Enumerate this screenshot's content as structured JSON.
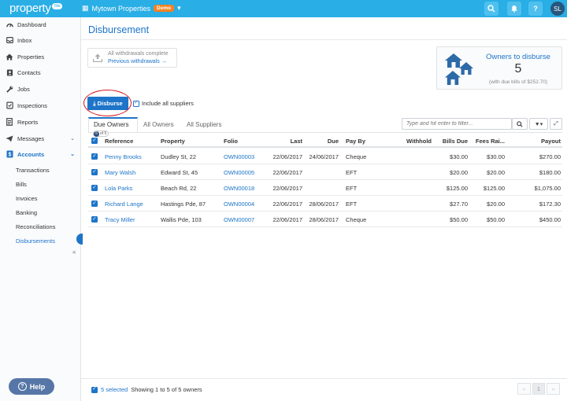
{
  "app": {
    "logo_text": "property",
    "logo_badge": "me"
  },
  "header": {
    "property_name": "Mytown Properties",
    "env_badge": "Demo",
    "avatar_initials": "SL"
  },
  "colors": {
    "brand_bar": "#29aee6",
    "accent": "#1d74c8",
    "demo_badge": "#f58220",
    "highlight_circle": "#d5141a"
  },
  "sidebar": {
    "items": [
      {
        "label": "Dashboard",
        "icon": "dashboard-icon"
      },
      {
        "label": "Inbox",
        "icon": "inbox-icon"
      },
      {
        "label": "Properties",
        "icon": "home-icon"
      },
      {
        "label": "Contacts",
        "icon": "contact-card-icon"
      },
      {
        "label": "Jobs",
        "icon": "wrench-icon"
      },
      {
        "label": "Inspections",
        "icon": "checklist-icon"
      },
      {
        "label": "Reports",
        "icon": "report-icon"
      },
      {
        "label": "Messages",
        "icon": "paper-plane-icon"
      },
      {
        "label": "Accounts",
        "icon": "dollar-book-icon"
      }
    ],
    "account_sub": [
      "Transactions",
      "Bills",
      "Invoices",
      "Banking",
      "Reconciliations",
      "Disbursements"
    ],
    "help_label": "Help"
  },
  "page": {
    "title": "Disbursement"
  },
  "withdrawals": {
    "status": "All withdrawals complete",
    "link": "Previous withdrawals →"
  },
  "summary": {
    "label": "Owners to disburse",
    "count": "5",
    "note": "(with due bills of $252.70)"
  },
  "actions": {
    "disburse_label": "Disburse",
    "include_label": "Include all suppliers"
  },
  "tabs": [
    "Due Owners",
    "All Owners",
    "All Suppliers"
  ],
  "selection_pill": {
    "count": "5",
    "of": "of 5"
  },
  "filter": {
    "placeholder": "Type and hit enter to filter..."
  },
  "table": {
    "headers": [
      "Reference",
      "Property",
      "Folio",
      "Last",
      "Due",
      "Pay By",
      "Withhold",
      "Bills Due",
      "Fees Rai...",
      "Payout"
    ],
    "rows": [
      {
        "reference": "Penny Brooks",
        "property": "Dudley St, 22",
        "folio": "OWN00003",
        "last": "22/06/2017",
        "due": "24/06/2017",
        "pay_by": "Cheque",
        "withhold": "",
        "bills_due": "$30.00",
        "fees": "$30.00",
        "payout": "$270.00"
      },
      {
        "reference": "Mary Walsh",
        "property": "Edward St, 45",
        "folio": "OWN00005",
        "last": "22/06/2017",
        "due": "",
        "pay_by": "EFT",
        "withhold": "",
        "bills_due": "$20.00",
        "fees": "$20.00",
        "payout": "$180.00"
      },
      {
        "reference": "Lola Parks",
        "property": "Beach Rd, 22",
        "folio": "OWN00018",
        "last": "22/06/2017",
        "due": "",
        "pay_by": "EFT",
        "withhold": "",
        "bills_due": "$125.00",
        "fees": "$125.00",
        "payout": "$1,075.00"
      },
      {
        "reference": "Richard Lange",
        "property": "Hastings Pde, 87",
        "folio": "OWN00004",
        "last": "22/06/2017",
        "due": "28/06/2017",
        "pay_by": "EFT",
        "withhold": "",
        "bills_due": "$27.70",
        "fees": "$20.00",
        "payout": "$172.30"
      },
      {
        "reference": "Tracy Miller",
        "property": "Wallis Pde, 103",
        "folio": "OWN00007",
        "last": "22/06/2017",
        "due": "28/06/2017",
        "pay_by": "Cheque",
        "withhold": "",
        "bills_due": "$50.00",
        "fees": "$50.00",
        "payout": "$450.00"
      }
    ]
  },
  "footer": {
    "selected": "5 selected",
    "showing": "Showing 1 to 5 of 5 owners",
    "page": "1"
  }
}
